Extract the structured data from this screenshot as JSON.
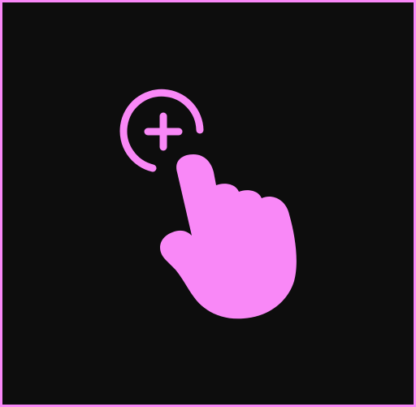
{
  "icon": {
    "name": "tap-add-icon",
    "color": "#f988f7",
    "background": "#0d0d0d",
    "border_color": "#f988f7"
  }
}
